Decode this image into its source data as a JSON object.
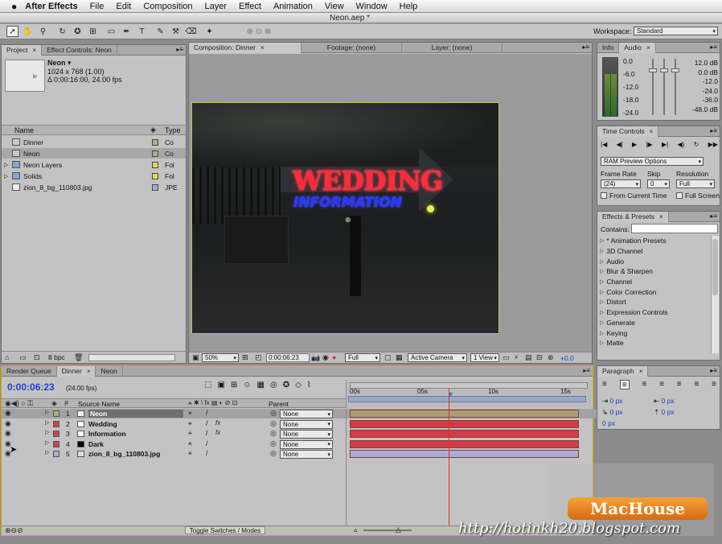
{
  "app": {
    "name": "After Effects",
    "window_title": "Neon.aep *"
  },
  "menu": [
    "File",
    "Edit",
    "Composition",
    "Layer",
    "Effect",
    "Animation",
    "View",
    "Window",
    "Help"
  ],
  "workspace": {
    "label": "Workspace:",
    "value": "Standard"
  },
  "project": {
    "tabs": [
      "Project",
      "Effect Controls: Neon"
    ],
    "item_name": "Neon ▾",
    "item_dims": "1024 x 768 (1.00)",
    "item_dur": "Δ 0:00:16:00, 24.00 fps",
    "col_name": "Name",
    "col_type": "Type",
    "items": [
      {
        "name": "Dinner",
        "type": "Co",
        "color": "#b9a98a",
        "icon": "comp-icon"
      },
      {
        "name": "Neon",
        "type": "Co",
        "color": "#b9a98a",
        "icon": "comp-icon"
      },
      {
        "name": "Neon Layers",
        "type": "Fol",
        "color": "#e6d84a",
        "icon": "folder-icon"
      },
      {
        "name": "Solids",
        "type": "Fol",
        "color": "#e6d84a",
        "icon": "folder-icon"
      },
      {
        "name": "zion_8_bg_110803.jpg",
        "type": "JPE",
        "color": "#a9a9d8",
        "icon": "image-icon"
      }
    ],
    "bpc": "8 bpc"
  },
  "viewer": {
    "tabs": [
      "Composition: Dinner",
      "Footage: (none)",
      "Layer: (none)"
    ],
    "sign_line1": "WEDDING",
    "sign_line2": "INFORMATION",
    "zoom": "50%",
    "time": "0:00:06:23",
    "resolution": "Full",
    "camera": "Active Camera",
    "views": "1 View",
    "exposure": "+0.0"
  },
  "info": {
    "tabs": [
      "Info",
      "Audio"
    ],
    "left_scale": [
      "0.0",
      "-6.0",
      "-12.0",
      "-18.0",
      "-24.0"
    ],
    "right_scale": [
      "12.0 dB",
      "0.0 dB",
      "-12.0",
      "-24.0",
      "-36.0",
      "-48.0 dB"
    ]
  },
  "time_controls": {
    "tab": "Time Controls",
    "ram": "RAM Preview Options",
    "fr_label": "Frame Rate",
    "fr_value": "(24)",
    "skip_label": "Skip",
    "skip_value": "0",
    "res_label": "Resolution",
    "res_value": "Full",
    "from_current": "From Current Time",
    "full_screen": "Full Screen"
  },
  "effects": {
    "tab": "Effects & Presets",
    "contains": "Contains:",
    "items": [
      "* Animation Presets",
      "3D Channel",
      "Audio",
      "Blur & Sharpen",
      "Channel",
      "Color Correction",
      "Distort",
      "Expression Controls",
      "Generate",
      "Keying",
      "Matte"
    ]
  },
  "paragraph": {
    "tab": "Paragraph",
    "values": [
      "0 px",
      "0 px",
      "0 px",
      "0 px",
      "0 px"
    ]
  },
  "timeline": {
    "tabs": [
      "Render Queue",
      "Dinner",
      "Neon"
    ],
    "timecode": "0:00:06:23",
    "fps": "(24.00 fps)",
    "col_source": "Source Name",
    "col_parent": "Parent",
    "ticks": [
      "00s",
      "05s",
      "10s",
      "15s"
    ],
    "toggle": "Toggle Switches / Modes",
    "layers": [
      {
        "num": "1",
        "name": "Neon",
        "label": "#b6a88c",
        "parent": "None",
        "bar": "#b09c72",
        "fx": false
      },
      {
        "num": "2",
        "name": "Wedding",
        "label": "#d6404a",
        "parent": "None",
        "bar": "#d23c46",
        "fx": true
      },
      {
        "num": "3",
        "name": "Information",
        "label": "#d6404a",
        "parent": "None",
        "bar": "#d23c46",
        "fx": true
      },
      {
        "num": "4",
        "name": "Dark",
        "label": "#d6404a",
        "parent": "None",
        "bar": "#d23c46",
        "fx": false
      },
      {
        "num": "5",
        "name": "zion_8_bg_110803.jpg",
        "label": "#a9a9d8",
        "parent": "None",
        "bar": "#b0a8d8",
        "fx": false
      }
    ]
  },
  "watermark": {
    "brand": "MacHouse",
    "url": "http://hotinkh20.blogspot.com"
  }
}
